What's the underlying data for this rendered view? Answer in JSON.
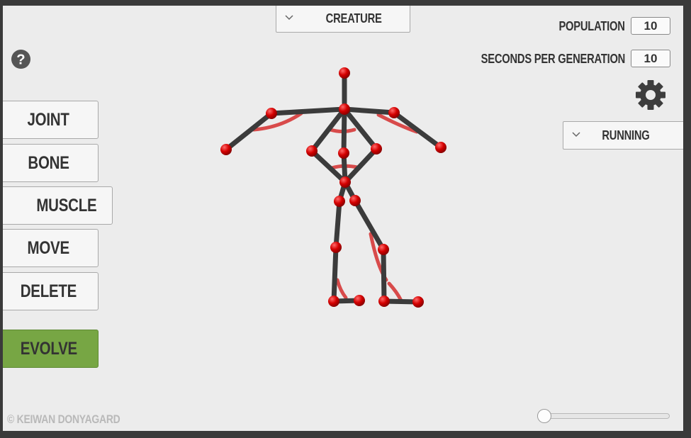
{
  "creature_dropdown": {
    "label": "CREATURE"
  },
  "tools": {
    "joint": "JOINT",
    "bone": "BONE",
    "muscle": "MUSCLE",
    "move": "MOVE",
    "delete": "DELETE",
    "evolve": "EVOLVE"
  },
  "settings": {
    "population_label": "POPULATION",
    "population_value": "10",
    "seconds_label": "SECONDS PER GENERATION",
    "seconds_value": "10"
  },
  "task_dropdown": {
    "label": "RUNNING"
  },
  "copyright": "© KEIWAN DONYAGARD",
  "slider": {
    "value": 0
  },
  "icons": {
    "help": "help-icon",
    "settings": "gear-icon",
    "dropdown": "chevron-down-icon"
  },
  "colors": {
    "background": "#ececec",
    "evolve_button": "#77a644",
    "joint": "#d40000",
    "bone": "#3b3b3b",
    "muscle": "#d63a3a"
  }
}
